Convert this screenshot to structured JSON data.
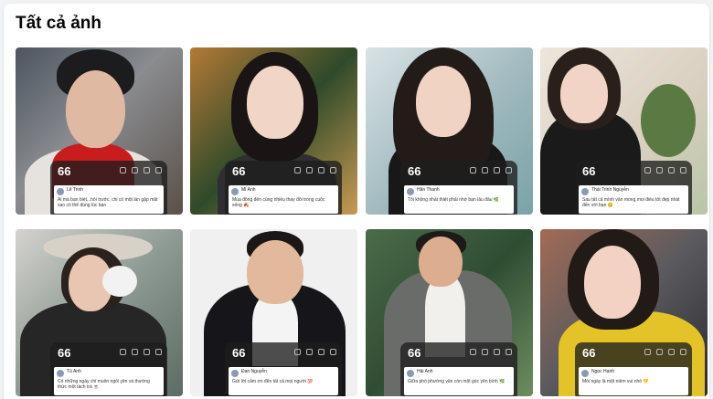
{
  "section": {
    "title": "Tất cả ảnh"
  },
  "tiles": [
    {
      "quote": "66",
      "author": "Lê Trinh",
      "text": "Ai mà bạn biết...hồi trước, chỉ có một lần gặp mặt sao có thể đúng lúc bạn"
    },
    {
      "quote": "66",
      "author": "Mì Anh",
      "text": "Mùa đông đến cùng nhiều thay đổi trong cuộc sống 🍂"
    },
    {
      "quote": "66",
      "author": "Hân Thanh",
      "text": "Tôi không nhất thiết phải nhớ bạn lâu đâu 🌿"
    },
    {
      "quote": "66",
      "author": "Thái Trinh Nguyễn",
      "text": "Sau tất cả mình vẫn mong mọi điều tốt đẹp nhất đến với bạn 😊"
    },
    {
      "quote": "66",
      "author": "Tú Anh",
      "text": "Có những ngày chỉ muốn ngồi yên và thưởng thức một tách trà ☕"
    },
    {
      "quote": "66",
      "author": "Đan Nguyễn",
      "text": "Gửi lời cảm ơn đến tất cả mọi người 💯"
    },
    {
      "quote": "66",
      "author": "Hải Anh",
      "text": "Giữa phố phường vẫn còn một góc yên bình 🌿"
    },
    {
      "quote": "66",
      "author": "Ngọc Hạnh",
      "text": "Mỗi ngày là một niềm vui nhỏ 💛"
    }
  ],
  "icons": [
    "heart-icon",
    "share-icon",
    "save-icon",
    "download-icon"
  ],
  "colors": {
    "page_bg": "#f0f2f5",
    "card_bg": "#ffffff",
    "overlay": "#1e1e1e"
  }
}
